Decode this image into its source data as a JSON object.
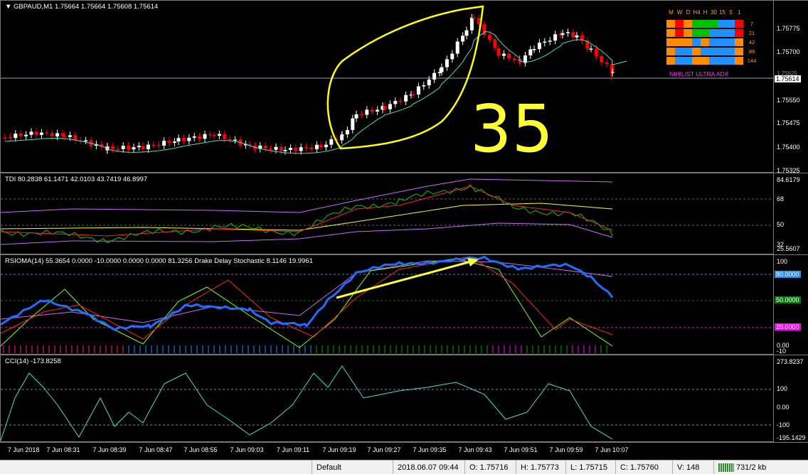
{
  "symbol_header": "GBPAUD,M1  1.75664 1.75664 1.75608 1.75614",
  "price_axis": [
    "1.75775",
    "1.75700",
    "1.75625",
    "1.75550",
    "1.75475",
    "1.75400",
    "1.75325"
  ],
  "current_price": "1.75614",
  "annotation_number": "35",
  "adx_panel": {
    "title": "NIHILIST ULTRA ADX",
    "timeframes": [
      "M",
      "W",
      "D",
      "H4",
      "H",
      "30",
      "15",
      "5",
      "1"
    ],
    "periods": [
      "7",
      "21",
      "42",
      "89",
      "144"
    ],
    "grid": [
      [
        "#ff8c00",
        "#ff0000",
        "#ff8c00",
        "#00c000",
        "#00c000",
        "#00c000",
        "#1e90ff",
        "#1e90ff",
        "#ff0000"
      ],
      [
        "#ff8c00",
        "#ff0000",
        "#ff8c00",
        "#00c000",
        "#00c000",
        "#1e90ff",
        "#1e90ff",
        "#1e90ff",
        "#ff0000"
      ],
      [
        "#ff8c00",
        "#ff8c00",
        "#ff8c00",
        "#1e90ff",
        "#ff8c00",
        "#1e90ff",
        "#1e90ff",
        "#1e90ff",
        "#ff8c00"
      ],
      [
        "#ff8c00",
        "#1e90ff",
        "#1e90ff",
        "#ff8c00",
        "#1e90ff",
        "#1e90ff",
        "#1e90ff",
        "#1e90ff",
        "#ff8c00"
      ],
      [
        "#ff8c00",
        "#1e90ff",
        "#1e90ff",
        "#ff8c00",
        "#ff8c00",
        "#1e90ff",
        "#1e90ff",
        "#1e90ff",
        "#ff8c00"
      ]
    ]
  },
  "tdi": {
    "label": "TDI 80.2838 61.1471 42.0103 43.7419 46.8997",
    "axis": [
      "84.6179",
      "68",
      "50",
      "32",
      "25.5607"
    ]
  },
  "rsioma": {
    "label": "RSIOMA(14) 55.3654 0.0000 -10.0000 0.0000 0.0000 81.3256  Drake Delay Stochastic 8.1146 19.9961",
    "axis": [
      "100",
      "80.0000",
      "50.0000",
      "20.0000",
      "0.00",
      "-10"
    ],
    "level_colors": {
      "upper": "#1e90ff",
      "middle": "#008000",
      "lower": "#ff00ff"
    }
  },
  "cci": {
    "label": "CCI(14) -173.8258",
    "axis": [
      "273.8237",
      "100",
      "0.00",
      "-100",
      "-195.1429"
    ]
  },
  "time_axis": [
    "7 Jun 2018",
    "7 Jun 08:31",
    "7 Jun 08:39",
    "7 Jun 08:47",
    "7 Jun 08:55",
    "7 Jun 09:03",
    "7 Jun 09:11",
    "7 Jun 09:19",
    "7 Jun 09:27",
    "7 Jun 09:35",
    "7 Jun 09:43",
    "7 Jun 09:51",
    "7 Jun 09:59",
    "7 Jun 10:07"
  ],
  "status_bar": {
    "profile": "Default",
    "datetime": "2018.06.07 09:44",
    "open": "O: 1.75716",
    "high": "H: 1.75773",
    "low": "L: 1.75715",
    "close": "C: 1.75760",
    "volume": "V: 148",
    "traffic": "731/2 kb"
  }
}
